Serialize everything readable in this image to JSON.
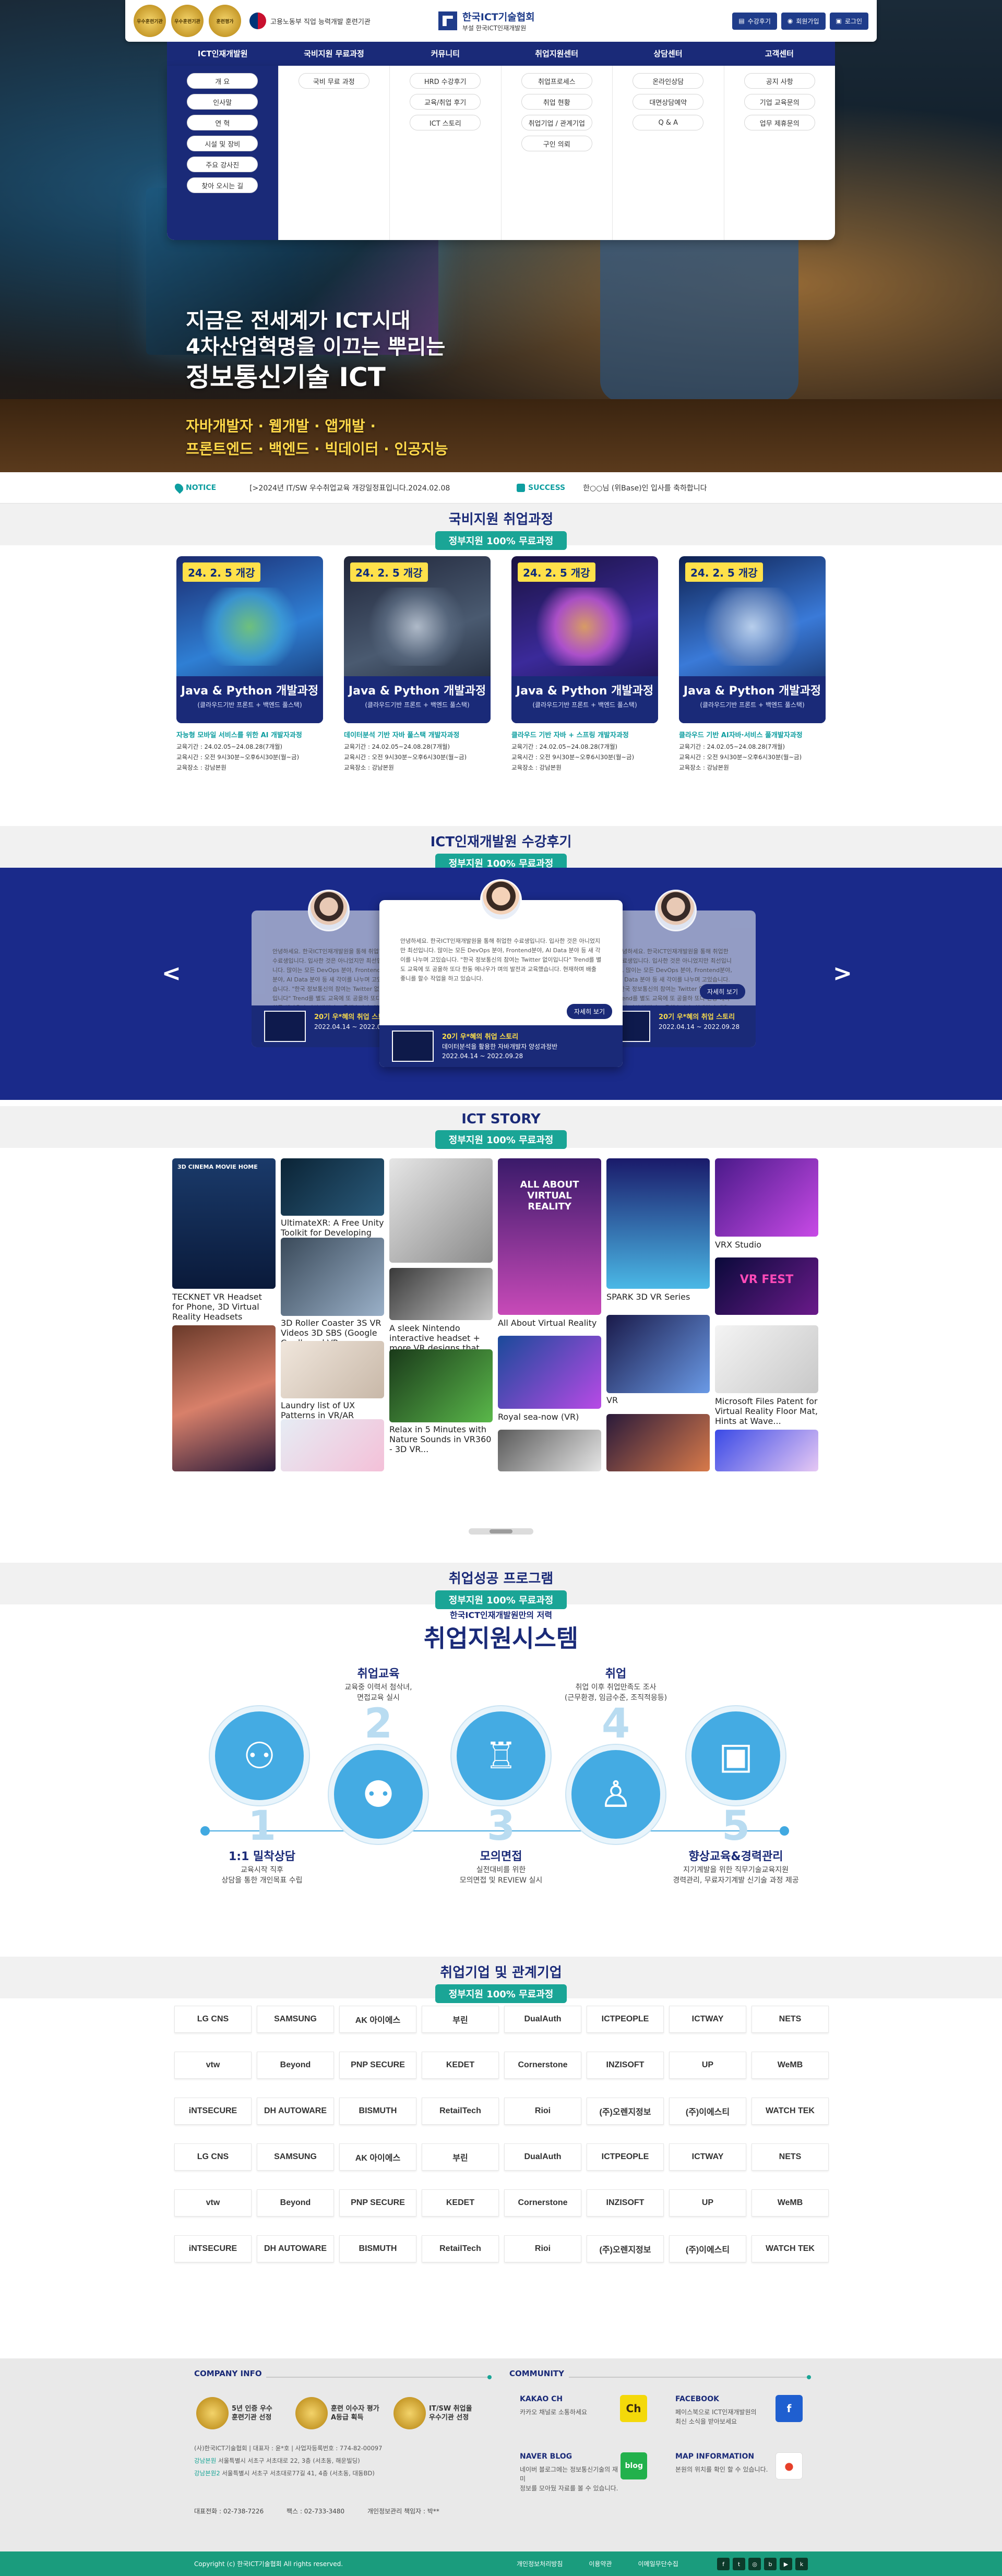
{
  "header": {
    "seals": [
      "우수훈련기관",
      "우수훈련기관",
      "훈련평가"
    ],
    "ministry": "고용노동부 직업 능력개발 훈련기관",
    "logo_name": "한국ICT기술협회",
    "logo_sub": "부설 한국ICT인재개발원",
    "util": [
      {
        "icon": "login-icon",
        "label": "수강후기"
      },
      {
        "icon": "user-icon",
        "label": "회원가입"
      },
      {
        "icon": "lock-icon",
        "label": "로그인"
      }
    ]
  },
  "gnb": [
    "ICT인재개발원",
    "국비지원 무료과정",
    "커뮤니티",
    "취업지원센터",
    "상담센터",
    "고객센터"
  ],
  "mega": [
    [
      "개 요",
      "인사말",
      "연 혁",
      "시설 및 장비",
      "주요 강사진",
      "찾아 오시는 길"
    ],
    [
      "국비 무료 과정"
    ],
    [
      "HRD 수강후기",
      "교육/취업 후기",
      "ICT 스토리"
    ],
    [
      "취업프로세스",
      "취업 현황",
      "취업기업 / 관계기업",
      "구인 의뢰"
    ],
    [
      "온라인상담",
      "대면상담예약",
      "Q & A"
    ],
    [
      "공지 사항",
      "기업 교육문의",
      "업무 제휴문의"
    ]
  ],
  "hero": {
    "line1": "지금은 전세계가 ICT시대",
    "line2": "4차산업혁명을 이끄는 뿌리는",
    "line3": "정보통신기술 ICT",
    "sub1": "자바개발자 · 웹개발 · 앱개발 ·",
    "sub2": "프론트엔드 · 백엔드 · 빅데이터 · 인공지능"
  },
  "notice": {
    "label": "NOTICE",
    "text": "[>2024년 IT/SW 우수취업교육 개강일정표입니다.2024.02.08",
    "success_label": "SUCCESS",
    "success_text": "한○○님 (위Base)인 입사를 축하합니다"
  },
  "courses_section": {
    "title": "국비지원 취업과정",
    "pill": "정부지원 100% 무료과정"
  },
  "courses": [
    {
      "badge": "24. 2. 5 개강",
      "name": "Java & Python 개발과정",
      "sub": "(클라우드기반 프론트 + 백엔드 풀스택)",
      "title": "자능형 모바일 서비스를 위한 AI 개발자과정",
      "period": "교육기간 : 24.02.05~24.08.28(7개월)",
      "time": "교육시간 : 오전 9시30분~오후6시30분(월~금)",
      "place": "교육장소 : 강남본원"
    },
    {
      "badge": "24. 2. 5 개강",
      "name": "Java & Python 개발과정",
      "sub": "(클라우드기반 프론트 + 백엔드 풀스택)",
      "title": "데이터분석 기반 자바 풀스택 개발자과정",
      "period": "교육기간 : 24.02.05~24.08.28(7개월)",
      "time": "교육시간 : 오전 9시30분~오후6시30분(월~금)",
      "place": "교육장소 : 강남본원"
    },
    {
      "badge": "24. 2. 5 개강",
      "name": "Java & Python 개발과정",
      "sub": "(클라우드기반 프론트 + 백엔드 풀스택)",
      "title": "클라우드 기반 자바 + 스프링 개발자과정",
      "period": "교육기간 : 24.02.05~24.08.28(7개월)",
      "time": "교육시간 : 오전 9시30분~오후6시30분(월~금)",
      "place": "교육장소 : 강남본원"
    },
    {
      "badge": "24. 2. 5 개강",
      "name": "Java & Python 개발과정",
      "sub": "(클라우드기반 프론트 + 백엔드 풀스택)",
      "title": "클라우드 기반 AI자바·서비스 풀개발자과정",
      "period": "교육기간 : 24.02.05~24.08.28(7개월)",
      "time": "교육시간 : 오전 9시30분~오후6시30분(월~금)",
      "place": "교육장소 : 강남본원"
    }
  ],
  "reviews_section": {
    "title": "ICT인재개발원 수강후기",
    "pill": "정부지원 100% 무료과정"
  },
  "review": {
    "text": "안녕하세요. 한국ICT인재개발원을 통해 취업한 수료생입니다. 입사한 것은 아니었지만 최선입니다. 많이는 모든 DevOps 분야, Frontend분야, AI Data 분야 등 새 각이를 나누며 고있습니다. \"한국 정보통신의 참여는 Twitter 없이입니다\" Trend를 별도 교육에 또 공을하 또다 한동 에나우가 며의 발전과 교육했습니다. 현재하며 배출 좋니를 할수 작업을 하고 있습니다.",
    "name": "20기 우*혜의 취업 스토리",
    "course": "데이터분석을 활용한 자바개발자 양성과정반",
    "date": "2022.04.14 ~ 2022.09.28",
    "more": "자세히 보기",
    "prev": "<",
    "next": ">"
  },
  "story_section": {
    "title": "ICT STORY",
    "pill": "정부지원 100% 무료과정"
  },
  "story": [
    {
      "caption": "TECKNET VR Headset for Phone, 3D Virtual Reality Headsets",
      "label": "3D CINEMA MOVIE HOME"
    },
    {
      "caption": "UltimateXR: A Free Unity Toolkit for Developing VR Games",
      "label": ""
    },
    {
      "caption": "3D Roller Coaster 3S VR Videos 3D SBS (Google Cardboard VR...",
      "label": ""
    },
    {
      "caption": "Laundry list of UX Patterns in VR/AR",
      "label": ""
    },
    {
      "caption": "A sleek Nintendo interactive headset + more VR designs that...",
      "label": ""
    },
    {
      "caption": "Relax in 5 Minutes with Nature Sounds in VR360 - 3D VR...",
      "label": ""
    },
    {
      "caption": "All About Virtual Reality",
      "label": "ALL ABOUT VIRTUAL REALITY"
    },
    {
      "caption": "Royal sea-now (VR)",
      "label": ""
    },
    {
      "caption": "SPARK 3D VR Series",
      "label": ""
    },
    {
      "caption": "VR",
      "label": ""
    },
    {
      "caption": "VRX Studio",
      "label": ""
    },
    {
      "caption": "Microsoft Files Patent for Virtual Reality Floor Mat, Hints at Wave...",
      "label": "VR FEST"
    }
  ],
  "emp_section": {
    "title": "취업성공 프로그램",
    "pill": "정부지원 100% 무료과정"
  },
  "emp": {
    "lead": "한국ICT인재개발원만의 저력",
    "title": "취업지원시스템",
    "steps": [
      {
        "num": "1",
        "title": "1:1 밀착상담",
        "desc": "교육시작 직후\n상담을 통한 개인목표 수립",
        "icon": "consult-icon"
      },
      {
        "num": "2",
        "title": "취업교육",
        "desc": "교육중 이력서 첨삭녀,\n면접교육 실시",
        "icon": "meeting-icon"
      },
      {
        "num": "3",
        "title": "모의면접",
        "desc": "실전대비를 위한\n모의면접 및 REVIEW 실시",
        "icon": "podium-icon"
      },
      {
        "num": "4",
        "title": "취업",
        "desc": "취업 이후 취업만족도 조사\n(근무환경, 임금수준, 조직적응등)",
        "icon": "employee-icon"
      },
      {
        "num": "5",
        "title": "향상교육&경력관리",
        "desc": "지기계발을 위한 직무기술교육지원\n경력관리, 무료자기계발 신기술 과정 제공",
        "icon": "presentation-icon"
      }
    ]
  },
  "partners_section": {
    "title": "취업기업 및 관계기업",
    "pill": "정부지원 100% 무료과정"
  },
  "partners": [
    "LG CNS",
    "SAMSUNG",
    "AK 아이에스",
    "부린",
    "DualAuth",
    "ICTPEOPLE",
    "ICTWAY",
    "NETS",
    "vtw",
    "Beyond",
    "PNP SECURE",
    "KEDET",
    "Cornerstone",
    "INZISOFT",
    "UP",
    "WeMB",
    "iNTSECURE",
    "DH AUTOWARE",
    "BISMUTH",
    "RetailTech",
    "Rioi",
    "(주)오렌지정보",
    "(주)이에스티",
    "WATCH TEK",
    "LG CNS",
    "SAMSUNG",
    "AK 아이에스",
    "부린",
    "DualAuth",
    "ICTPEOPLE",
    "ICTWAY",
    "NETS",
    "vtw",
    "Beyond",
    "PNP SECURE",
    "KEDET",
    "Cornerstone",
    "INZISOFT",
    "UP",
    "WeMB",
    "iNTSECURE",
    "DH AUTOWARE",
    "BISMUTH",
    "RetailTech",
    "Rioi",
    "(주)오렌지정보",
    "(주)이에스티",
    "WATCH TEK"
  ],
  "footer": {
    "company_head": "COMPANY INFO",
    "community_head": "COMMUNITY",
    "badges": [
      {
        "label": "5년 인증 우수\n훈련기관 선정"
      },
      {
        "label": "훈련 이수자 평가\nA등급 획득"
      },
      {
        "label": "IT/SW 취업율\n우수기관 선정"
      }
    ],
    "info1": "(사)한국ICT기술협회 | 대표자 : 윤*호 | 사업자등록번호 : 774-82-00097",
    "info2_h": "강남본원",
    "info2": " 서울특별시 서초구 서초대로 22, 3층 (서초동, 해운빌딩)",
    "info3_h": "강남본원2",
    "info3": " 서울특별시 서초구 서초대로77길 41, 4층 (서초동, 대동BD)",
    "tel": "대표전화 : 02-738-7226",
    "fax": "팩스 : 02-733-3480",
    "privacy": "개인정보관리 책임자 : 박**",
    "kakao": {
      "title": "KAKAO CH",
      "desc": "카카오 채널로 소통하세요"
    },
    "facebook": {
      "title": "FACEBOOK",
      "desc": "페이스북으로 ICT인재개발원의\n최신 소식을 받아보세요"
    },
    "naver": {
      "title": "NAVER BLOG",
      "desc": "네이버 블로그에는 정보통신기술의 재미\n정보를 모아뒀 자료를 볼 수 있습니다."
    },
    "map": {
      "title": "MAP INFORMATION",
      "desc": "본원의 위치를 확인 할 수 있습니다."
    },
    "copyright": "Copyright (c) 한국ICT기술협회 All rights reserved.",
    "links": [
      "개인정보처리방침",
      "이용약관",
      "이메일무단수집"
    ]
  }
}
